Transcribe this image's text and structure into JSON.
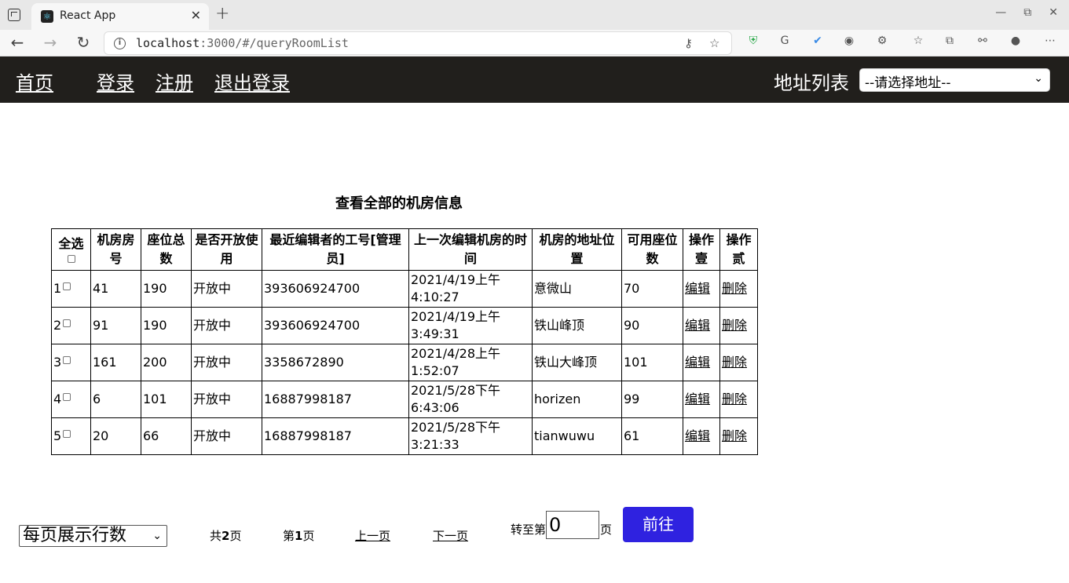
{
  "browser": {
    "tab_title": "React App",
    "url_host": "localhost",
    "url_rest": ":3000/#/queryRoomList"
  },
  "navbar": {
    "home": "首页",
    "login": "登录",
    "register": "注册",
    "logout": "退出登录",
    "address_label": "地址列表",
    "address_select": "--请选择地址--"
  },
  "main": {
    "title": "查看全部的机房信息",
    "headers": {
      "select_all": "全选",
      "room_no": "机房房号",
      "seats_total": "座位总数",
      "is_open": "是否开放使用",
      "editor_id": "最近编辑者的工号[管理员]",
      "last_edit_time": "上一次编辑机房的时间",
      "address": "机房的地址位置",
      "available_seats": "可用座位数",
      "op1": "操作壹",
      "op2": "操作贰"
    },
    "rows": [
      {
        "idx": "1",
        "room": "41",
        "seats": "190",
        "open": "开放中",
        "editor": "393606924700",
        "time": "2021/4/19上午4:10:27",
        "addr": "意微山",
        "avail": "70",
        "edit": "编辑",
        "del": "删除"
      },
      {
        "idx": "2",
        "room": "91",
        "seats": "190",
        "open": "开放中",
        "editor": "393606924700",
        "time": "2021/4/19上午3:49:31",
        "addr": "铁山峰顶",
        "avail": "90",
        "edit": "编辑",
        "del": "删除"
      },
      {
        "idx": "3",
        "room": "161",
        "seats": "200",
        "open": "开放中",
        "editor": "3358672890",
        "time": "2021/4/28上午1:52:07",
        "addr": "铁山大峰顶",
        "avail": "101",
        "edit": "编辑",
        "del": "删除"
      },
      {
        "idx": "4",
        "room": "6",
        "seats": "101",
        "open": "开放中",
        "editor": "16887998187",
        "time": "2021/5/28下午6:43:06",
        "addr": "horizen",
        "avail": "99",
        "edit": "编辑",
        "del": "删除"
      },
      {
        "idx": "5",
        "room": "20",
        "seats": "66",
        "open": "开放中",
        "editor": "16887998187",
        "time": "2021/5/28下午3:21:33",
        "addr": "tianwuwu",
        "avail": "61",
        "edit": "编辑",
        "del": "删除"
      }
    ]
  },
  "pagination": {
    "page_size_select": "每页展示行数",
    "total_prefix": "共",
    "total_pages": "2",
    "page_suffix": "页",
    "current_prefix": "第",
    "current_page": "1",
    "prev": "上一页",
    "next": "下一页",
    "goto_label": "转至第",
    "goto_value": "0",
    "goto_unit": "页",
    "go_button": "前往"
  }
}
